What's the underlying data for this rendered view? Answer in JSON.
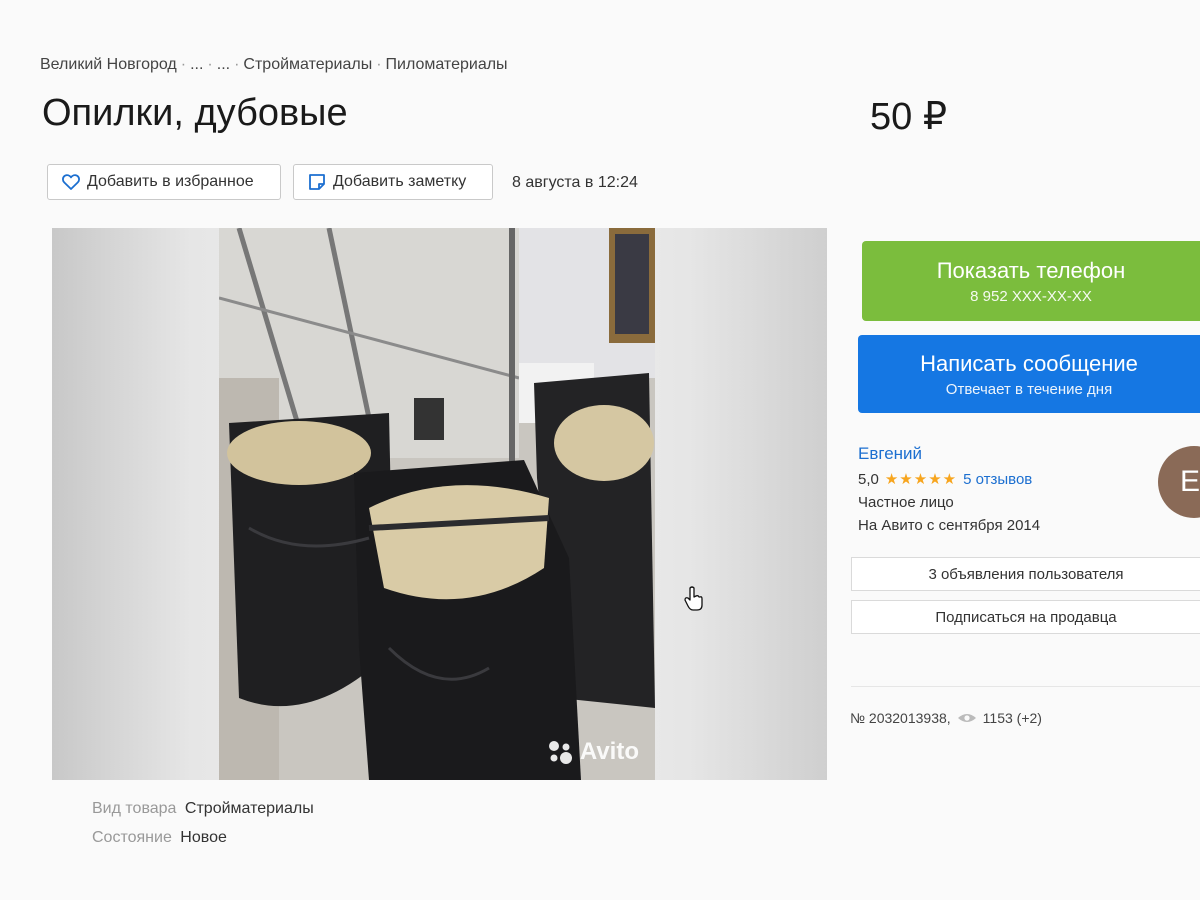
{
  "breadcrumb": {
    "items": [
      "Великий Новгород",
      "...",
      "...",
      "Стройматериалы",
      "Пиломатериалы"
    ]
  },
  "listing": {
    "title": "Опилки, дубовые",
    "price": "50 ₽",
    "date": "8 августа в 12:24"
  },
  "actions": {
    "favorite_label": "Добавить в избранное",
    "note_label": "Добавить заметку"
  },
  "gallery": {
    "watermark": "Avito"
  },
  "contact": {
    "phone_label": "Показать телефон",
    "phone_number": "8 952 XXX-XX-XX",
    "message_label": "Написать сообщение",
    "message_sub": "Отвечает в течение дня"
  },
  "seller": {
    "name": "Евгений",
    "rating": "5,0",
    "stars": "★★★★★",
    "reviews": "5 отзывов",
    "type": "Частное лицо",
    "since": "На Авито с сентября 2014",
    "avatar_letter": "Е",
    "ads_label": "3 объявления пользователя",
    "subscribe_label": "Подписаться на продавца"
  },
  "meta": {
    "number": "№ 2032013938,",
    "views": "1153 (+2)"
  },
  "params": [
    {
      "label": "Вид товара",
      "value": "Стройматериалы"
    },
    {
      "label": "Состояние",
      "value": "Новое"
    }
  ],
  "colors": {
    "phone_button": "#7bbd3d",
    "message_button": "#1577e3",
    "link": "#1c6fd0",
    "stars": "#f7a51e"
  }
}
